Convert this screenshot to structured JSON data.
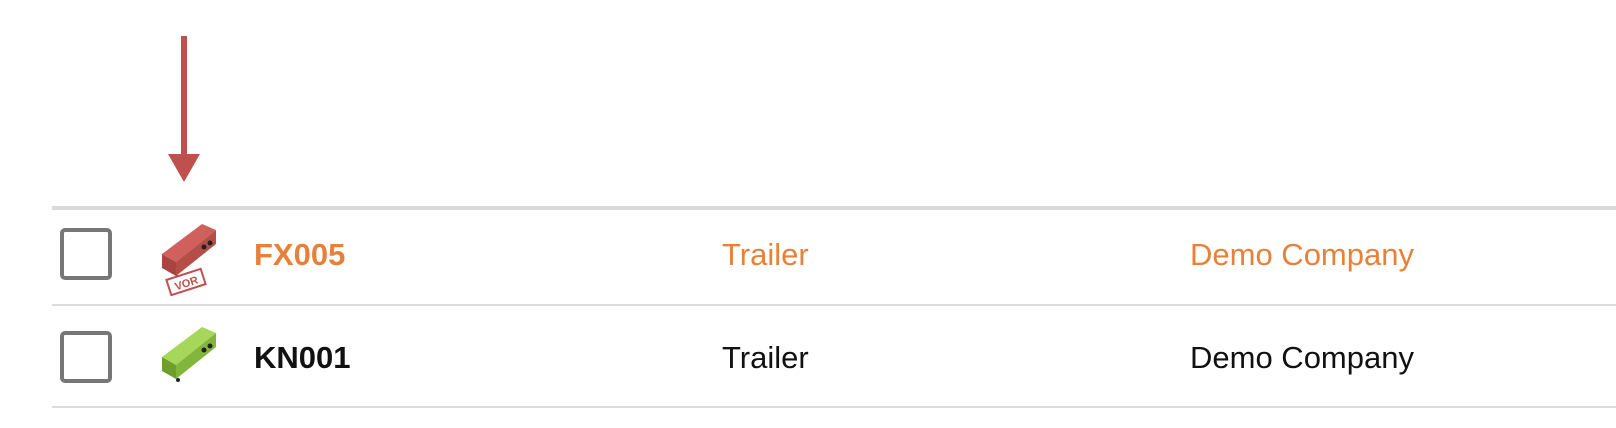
{
  "colors": {
    "arrow": "#c0504d",
    "highlight_text": "#e8803a",
    "normal_text": "#111111",
    "vor_vehicle": "#c0504d",
    "ok_vehicle": "#8dc63f"
  },
  "rows": [
    {
      "id": "FX005",
      "type": "Trailer",
      "company": "Demo Company",
      "icon": "trailer-red-vor-icon",
      "badge": "VOR",
      "highlighted": true
    },
    {
      "id": "KN001",
      "type": "Trailer",
      "company": "Demo Company",
      "icon": "trailer-green-icon",
      "highlighted": false
    }
  ]
}
